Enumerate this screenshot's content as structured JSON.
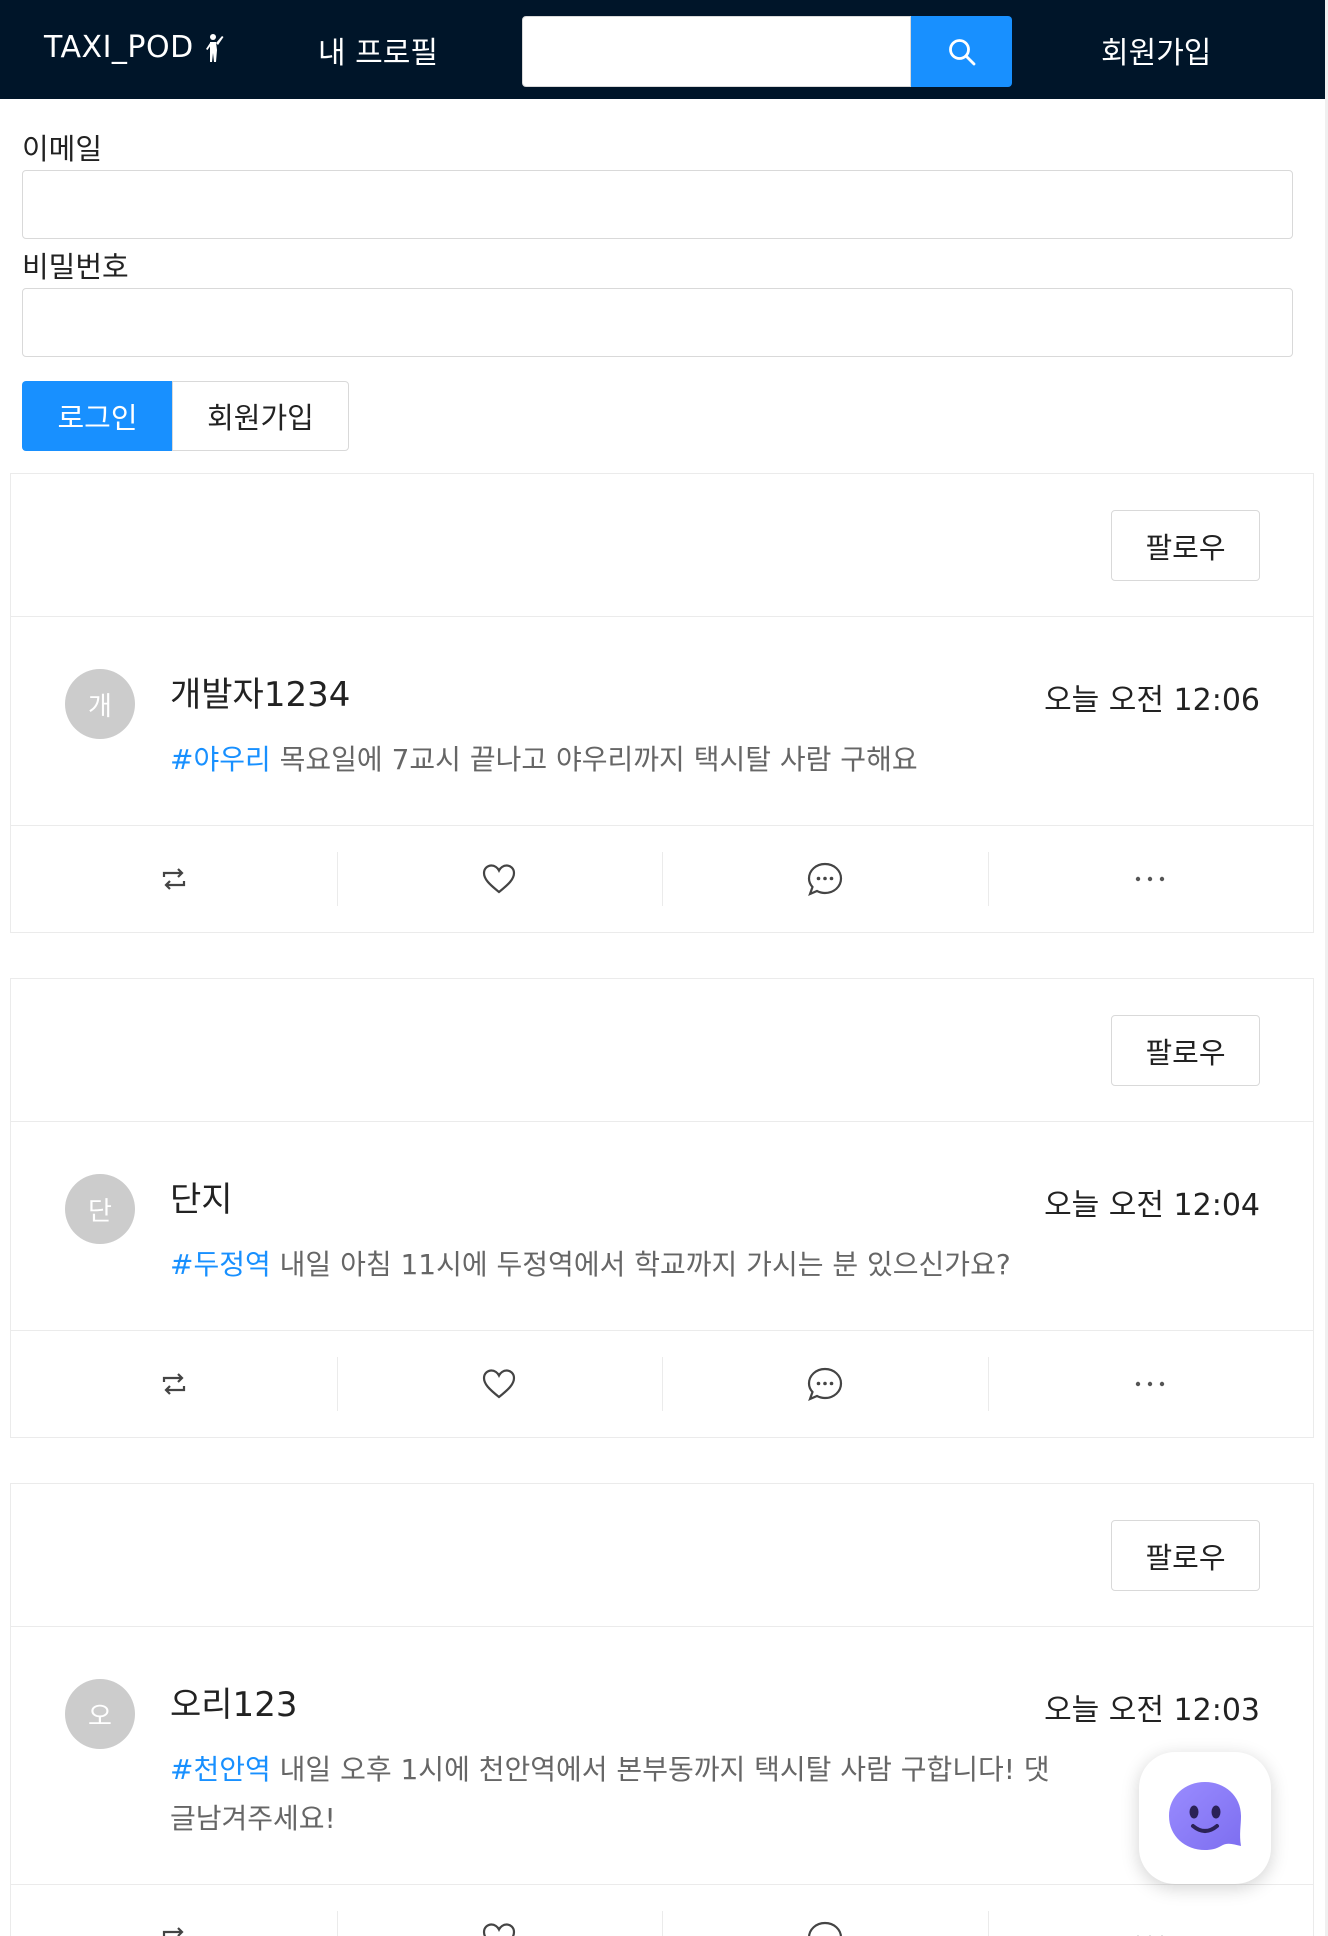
{
  "header": {
    "logo_text": "TAXI_POD",
    "logo_icon": "person-hailing-icon",
    "nav_profile": "내 프로필",
    "search": {
      "placeholder": "",
      "value": ""
    },
    "nav_signup": "회원가입"
  },
  "login": {
    "email_label": "이메일",
    "email_value": "",
    "password_label": "비밀번호",
    "password_value": "",
    "login_button": "로그인",
    "signup_button": "회원가입"
  },
  "posts": [
    {
      "follow_label": "팔로우",
      "avatar": "개",
      "author": "개발자1234",
      "time": "오늘 오전 12:06",
      "hashtag": "#야우리",
      "text": " 목요일에 7교시 끝나고 야우리까지 택시탈 사람 구해요"
    },
    {
      "follow_label": "팔로우",
      "avatar": "단",
      "author": "단지",
      "time": "오늘 오전 12:04",
      "hashtag": "#두정역",
      "text": " 내일 아침 11시에 두정역에서 학교까지 가시는 분 있으신가요?"
    },
    {
      "follow_label": "팔로우",
      "avatar": "오",
      "author": "오리123",
      "time": "오늘 오전 12:03",
      "hashtag": "#천안역",
      "text": " 내일 오후 1시에 천안역에서 본부동까지 택시탈 사람 구합니다! 댓글남겨주세요!"
    }
  ],
  "actions": [
    "retweet-icon",
    "heart-icon",
    "comment-icon",
    "ellipsis-icon"
  ],
  "colors": {
    "header_bg": "#001529",
    "primary": "#1890ff",
    "avatar_bg": "#cccccc",
    "chatbot_purple": "#8b7cf6"
  }
}
